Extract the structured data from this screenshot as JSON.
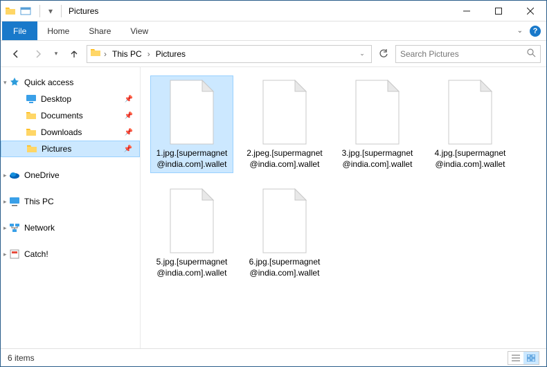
{
  "title_bar": {
    "title": "Pictures"
  },
  "ribbon": {
    "file_label": "File",
    "tabs": [
      "Home",
      "Share",
      "View"
    ]
  },
  "nav": {
    "crumbs": [
      "This PC",
      "Pictures"
    ],
    "search_placeholder": "Search Pictures"
  },
  "sidebar": {
    "quick_access": {
      "label": "Quick access",
      "items": [
        {
          "label": "Desktop",
          "pinned": true,
          "icon": "desktop"
        },
        {
          "label": "Documents",
          "pinned": true,
          "icon": "folder"
        },
        {
          "label": "Downloads",
          "pinned": true,
          "icon": "folder"
        },
        {
          "label": "Pictures",
          "pinned": true,
          "icon": "folder",
          "selected": true
        }
      ]
    },
    "root_items": [
      {
        "label": "OneDrive",
        "icon": "onedrive"
      },
      {
        "label": "This PC",
        "icon": "thispc"
      },
      {
        "label": "Network",
        "icon": "network"
      },
      {
        "label": "Catch!",
        "icon": "catch"
      }
    ]
  },
  "files": [
    {
      "name": "1.jpg.[supermagnet@india.com].wallet",
      "selected": true
    },
    {
      "name": "2.jpeg.[supermagnet@india.com].wallet"
    },
    {
      "name": "3.jpg.[supermagnet@india.com].wallet"
    },
    {
      "name": "4.jpg.[supermagnet@india.com].wallet"
    },
    {
      "name": "5.jpg.[supermagnet@india.com].wallet"
    },
    {
      "name": "6.jpg.[supermagnet@india.com].wallet"
    }
  ],
  "statusbar": {
    "count_label": "6 items"
  }
}
